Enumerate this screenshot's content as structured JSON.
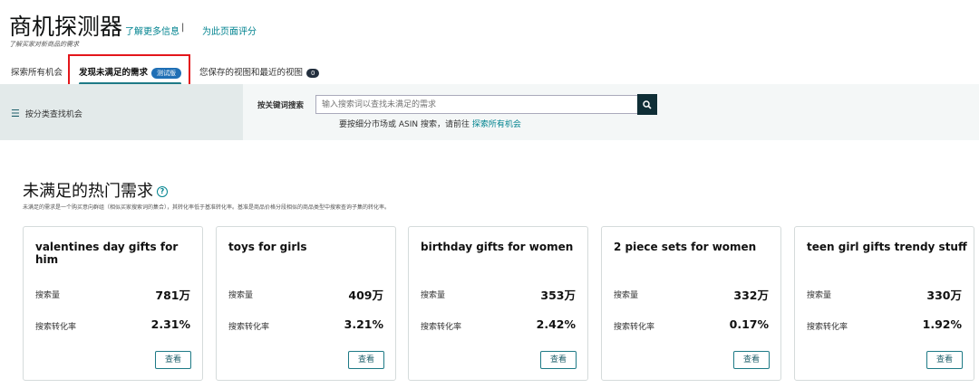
{
  "header": {
    "title": "商机探测器",
    "learn_more": "了解更多信息",
    "separator": "|",
    "rate_page": "为此页面评分",
    "subtitle": "了解买家对新商品的需求"
  },
  "tabs": [
    {
      "label": "探索所有机会"
    },
    {
      "label": "发现未满足的需求",
      "badge": "测试版"
    },
    {
      "label": "您保存的视图和最近的视图",
      "badge": "0"
    }
  ],
  "sidebar": {
    "category_label": "按分类查找机会"
  },
  "search": {
    "label": "按关键词搜索",
    "placeholder": "输入搜索词以查找未满足的需求",
    "hint": "要按细分市场或 ASIN 搜索，请前往",
    "hint_link": "探索所有机会"
  },
  "section": {
    "title": "未满足的热门需求",
    "description": "未满足的需求是一个购买意向群组（相似买家搜索词的集合），其转化率低于基准转化率。基准是商品价格分段相似的商品类型中搜索查询子集的转化率。"
  },
  "card_labels": {
    "volume": "搜索量",
    "conversion": "搜索转化率",
    "view": "查看"
  },
  "cards": [
    {
      "name": "valentines day gifts for him",
      "volume": "781万",
      "conversion": "2.31%"
    },
    {
      "name": "toys for girls",
      "volume": "409万",
      "conversion": "3.21%"
    },
    {
      "name": "birthday gifts for women",
      "volume": "353万",
      "conversion": "2.42%"
    },
    {
      "name": "2 piece sets for women",
      "volume": "332万",
      "conversion": "0.17%"
    },
    {
      "name": "teen girl gifts trendy stuff",
      "volume": "330万",
      "conversion": "1.92%"
    }
  ]
}
